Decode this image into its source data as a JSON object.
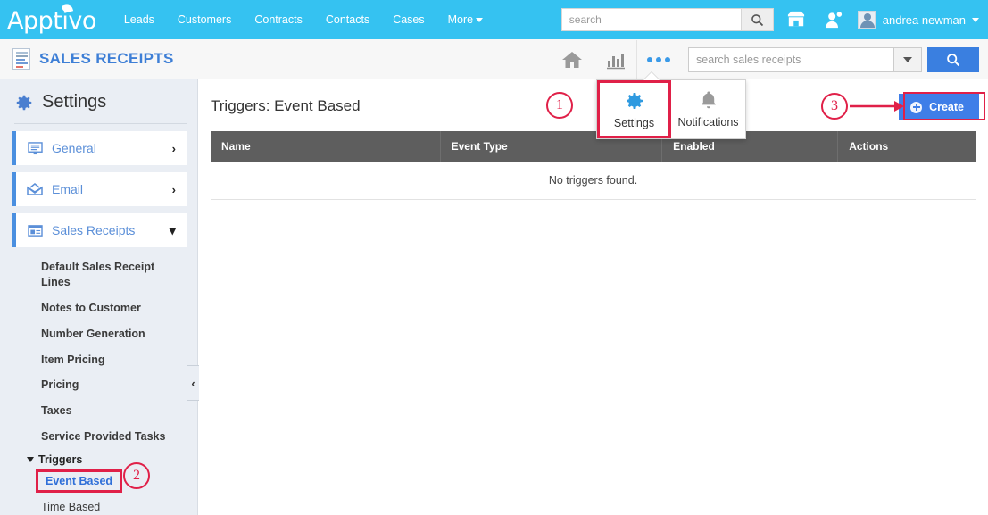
{
  "topbar": {
    "logo": "Apptivo",
    "nav": [
      {
        "label": "Leads"
      },
      {
        "label": "Customers"
      },
      {
        "label": "Contracts"
      },
      {
        "label": "Contacts"
      },
      {
        "label": "Cases"
      },
      {
        "label": "More"
      }
    ],
    "search": {
      "value": "",
      "placeholder": "search"
    },
    "user": {
      "name": "andrea newman"
    },
    "icons": {
      "store": "store-icon",
      "people": "people-icon",
      "search": "search-icon"
    }
  },
  "secondbar": {
    "app_title": "SALES RECEIPTS",
    "tools": [
      {
        "name": "home-icon"
      },
      {
        "name": "reports-chart-icon"
      },
      {
        "name": "more-dots-icon"
      }
    ],
    "search": {
      "value": "",
      "placeholder": "search sales receipts"
    }
  },
  "popup": {
    "items": [
      {
        "label": "Settings",
        "icon": "gear-icon",
        "highlighted": true
      },
      {
        "label": "Notifications",
        "icon": "bell-icon",
        "highlighted": false
      }
    ]
  },
  "sidebar": {
    "heading": "Settings",
    "main_items": [
      {
        "label": "General",
        "icon": "monitor-icon",
        "arrow": "›",
        "expanded": false
      },
      {
        "label": "Email",
        "icon": "envelope-icon",
        "arrow": "›",
        "expanded": false
      },
      {
        "label": "Sales Receipts",
        "icon": "window-icon",
        "arrow": "⌄",
        "expanded": true
      }
    ],
    "sub_items": [
      "Default Sales Receipt Lines",
      "Notes to Customer",
      "Number Generation",
      "Item Pricing",
      "Pricing",
      "Taxes",
      "Service Provided Tasks"
    ],
    "group": {
      "label": "Triggers",
      "children": [
        {
          "label": "Event Based",
          "active": true
        },
        {
          "label": "Time Based",
          "active": false
        }
      ]
    },
    "collapse_handle": "‹"
  },
  "main": {
    "page_title": "Triggers: Event Based",
    "create_label": "Create",
    "table": {
      "columns": [
        "Name",
        "Event Type",
        "Enabled",
        "Actions"
      ],
      "rows": [],
      "empty_message": "No triggers found."
    }
  },
  "annotations": [
    {
      "number": "1",
      "target": "settings-popup-item"
    },
    {
      "number": "2",
      "target": "sidebar-event-based"
    },
    {
      "number": "3",
      "target": "create-button"
    }
  ],
  "colors": {
    "brand_blue": "#35c2f1",
    "accent_blue": "#3f7ee8",
    "link_blue": "#5b8fd8",
    "annotation_red": "#e02048",
    "table_header": "#5e5e5e",
    "sidebar_bg": "#eaeef4"
  }
}
